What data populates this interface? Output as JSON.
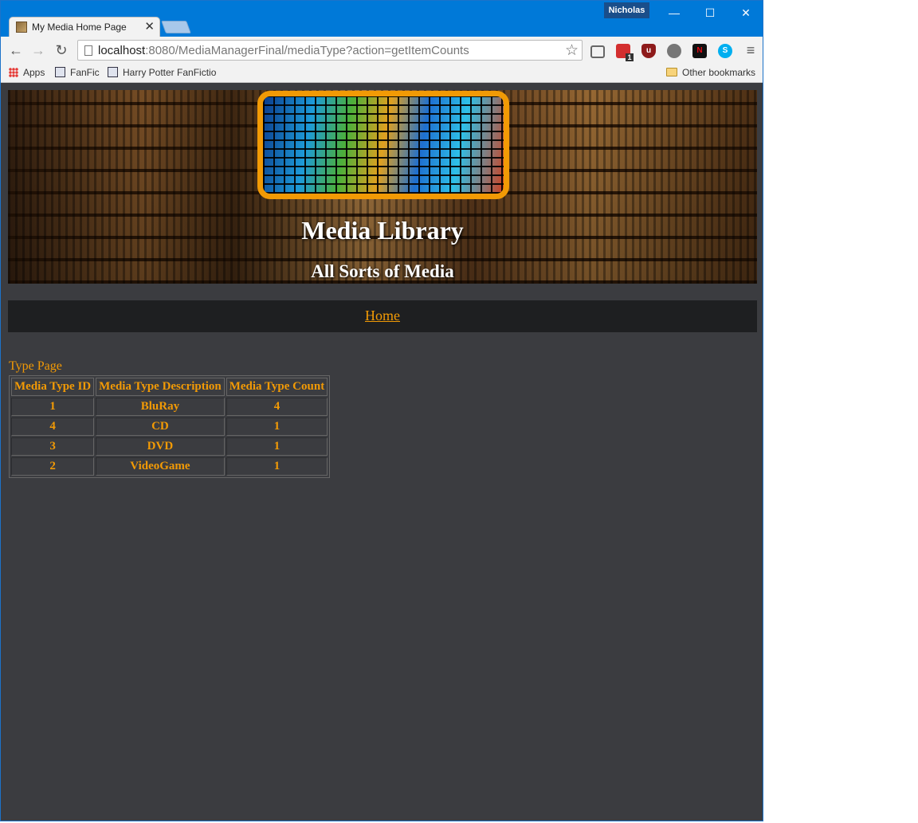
{
  "browser": {
    "tab_title": "My Media Home Page",
    "tab_close": "✕",
    "profile_name": "Nicholas",
    "url_host": "localhost",
    "url_rest": ":8080/MediaManagerFinal/mediaType?action=getItemCounts",
    "bookmarks": {
      "apps": "Apps",
      "fanfic": "FanFic",
      "hp_fanfic": "Harry Potter FanFictio",
      "other": "Other bookmarks"
    },
    "extension_badge": "1"
  },
  "header": {
    "title": "Media Library",
    "subtitle": "All Sorts of Media"
  },
  "nav": {
    "home_label": "Home"
  },
  "main": {
    "heading": "Type Page",
    "table": {
      "columns": [
        "Media Type ID",
        "Media Type Description",
        "Media Type Count"
      ],
      "rows": [
        [
          "1",
          "BluRay",
          "4"
        ],
        [
          "4",
          "CD",
          "1"
        ],
        [
          "3",
          "DVD",
          "1"
        ],
        [
          "2",
          "VideoGame",
          "1"
        ]
      ]
    }
  },
  "colors": {
    "accent": "#f29a05",
    "page_background": "#3b3c40",
    "navbar_background": "#1e1f21"
  }
}
